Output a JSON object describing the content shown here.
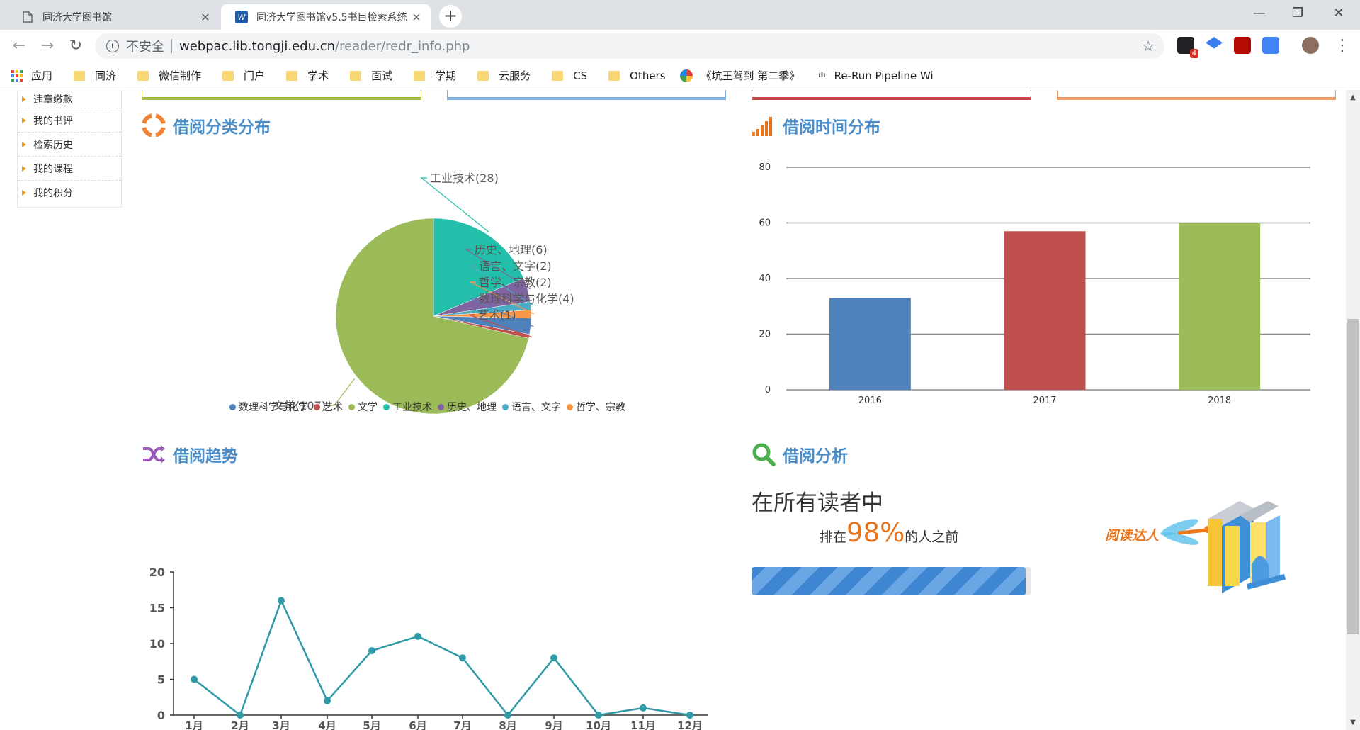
{
  "browser": {
    "tabs": [
      {
        "title": "同济大学图书馆",
        "active": false
      },
      {
        "title": "同济大学图书馆v5.5书目检索系统",
        "active": true
      }
    ],
    "new_tab": "+",
    "window_controls": {
      "minimize": "—",
      "maximize": "❐",
      "close": "✕"
    },
    "security_label": "不安全",
    "url_host": "webpac.lib.tongji.edu.cn",
    "url_path": "/reader/redr_info.php",
    "extension_badge": "4",
    "bookmarks": [
      "应用",
      "同济",
      "微信制作",
      "门户",
      "学术",
      "面试",
      "学期",
      "云服务",
      "CS",
      "Others",
      "《坑王驾到 第二季》",
      "Re-Run Pipeline Wi"
    ]
  },
  "sidebar": {
    "items": [
      "违章缴款",
      "我的书评",
      "检索历史",
      "我的课程",
      "我的积分"
    ]
  },
  "sections": {
    "category": "借阅分类分布",
    "time": "借阅时间分布",
    "trend": "借阅趋势",
    "analysis": "借阅分析"
  },
  "analysis": {
    "line1": "在所有读者中",
    "prefix": "排在",
    "percent": "98%",
    "suffix": "的人之前",
    "progress": 0.98,
    "badge_text": "阅读达人"
  },
  "colors": {
    "accent_blue": "#4a8dc9",
    "orange": "#e8741c",
    "stat_boxes": [
      "#9fb944",
      "#7fafdc",
      "#c9494b",
      "#ef9a63"
    ]
  },
  "chart_data": [
    {
      "type": "pie",
      "title": "借阅分类分布",
      "slices": [
        {
          "label": "文学",
          "value": 107,
          "color": "#9bbb59"
        },
        {
          "label": "工业技术",
          "value": 28,
          "color": "#23bfaa"
        },
        {
          "label": "历史、地理",
          "value": 6,
          "color": "#8064a2"
        },
        {
          "label": "语言、文字",
          "value": 2,
          "color": "#4bacc6"
        },
        {
          "label": "哲学、宗教",
          "value": 2,
          "color": "#f79646"
        },
        {
          "label": "数理科学与化学",
          "value": 4,
          "color": "#4f81bd"
        },
        {
          "label": "艺术",
          "value": 1,
          "color": "#c0504d"
        }
      ],
      "slice_labels": [
        "文学(107)",
        "工业技术(28)",
        "历史、地理(6)",
        "语言、文字(2)",
        "哲学、宗教(2)",
        "数理科学与化学(4)",
        "艺术(1)"
      ],
      "legend": [
        {
          "label": "数理科学与化学",
          "color": "#4f81bd"
        },
        {
          "label": "艺术",
          "color": "#c0504d"
        },
        {
          "label": "文学",
          "color": "#9bbb59"
        },
        {
          "label": "工业技术",
          "color": "#23bfaa"
        },
        {
          "label": "历史、地理",
          "color": "#8064a2"
        },
        {
          "label": "语言、文字",
          "color": "#4bacc6"
        },
        {
          "label": "哲学、宗教",
          "color": "#f79646"
        }
      ],
      "legend_position": "bottom"
    },
    {
      "type": "bar",
      "title": "借阅时间分布",
      "categories": [
        "2016",
        "2017",
        "2018"
      ],
      "values": [
        33,
        57,
        60
      ],
      "colors": [
        "#4f81bd",
        "#c0504d",
        "#9bbb59"
      ],
      "yticks": [
        "0",
        "20",
        "40",
        "60",
        "80"
      ],
      "ylim": [
        0,
        80
      ],
      "grid": true
    },
    {
      "type": "line",
      "title": "借阅趋势",
      "categories": [
        "1月",
        "2月",
        "3月",
        "4月",
        "5月",
        "6月",
        "7月",
        "8月",
        "9月",
        "10月",
        "11月",
        "12月"
      ],
      "values": [
        5,
        0,
        16,
        2,
        9,
        11,
        8,
        0,
        8,
        0,
        1,
        0
      ],
      "yticks": [
        "0",
        "5",
        "10",
        "15",
        "20"
      ],
      "ylim": [
        0,
        20
      ],
      "color": "#2f9aa7",
      "grid": false
    }
  ]
}
